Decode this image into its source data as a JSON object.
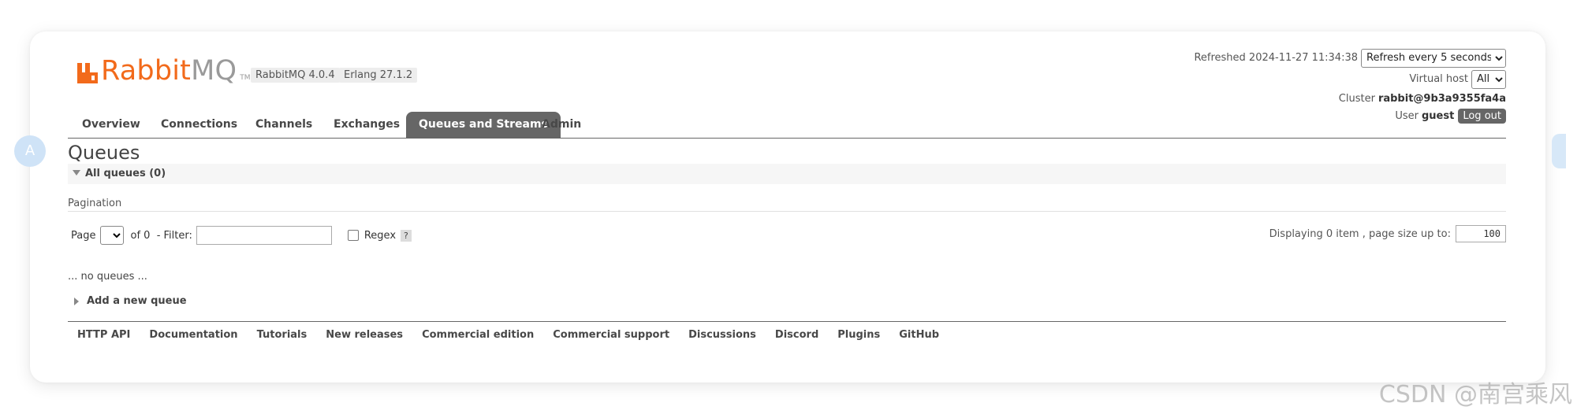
{
  "brand": {
    "name_orange": "Rabbit",
    "name_gray": "MQ",
    "tm": "TM",
    "rabbitmq_version": "RabbitMQ 4.0.4",
    "erlang_version": "Erlang 27.1.2",
    "colors": {
      "accent": "#f26a1b",
      "tab_active": "#666666"
    }
  },
  "status": {
    "refreshed_label": "Refreshed",
    "refreshed_time": "2024-11-27 11:34:38",
    "refresh_option": "Refresh every 5 seconds",
    "vhost_label": "Virtual host",
    "vhost_value": "All",
    "cluster_label": "Cluster",
    "cluster_value": "rabbit@9b3a9355fa4a",
    "user_label": "User",
    "user_value": "guest",
    "logout_label": "Log out"
  },
  "tabs": [
    {
      "label": "Overview",
      "active": false
    },
    {
      "label": "Connections",
      "active": false
    },
    {
      "label": "Channels",
      "active": false
    },
    {
      "label": "Exchanges",
      "active": false
    },
    {
      "label": "Queues and Streams",
      "active": true
    },
    {
      "label": "Admin",
      "active": false
    }
  ],
  "page": {
    "title": "Queues",
    "section_title": "All queues (0)",
    "pagination_label": "Pagination",
    "page_label": "Page",
    "of_label": "of 0",
    "filter_label": "- Filter:",
    "filter_value": "",
    "regex_label": "Regex",
    "help_label": "?",
    "display_label": "Displaying 0 item , page size up to:",
    "page_size": "100",
    "empty_text": "... no queues ...",
    "add_queue_label": "Add a new queue"
  },
  "footer": {
    "links": [
      "HTTP API",
      "Documentation",
      "Tutorials",
      "New releases",
      "Commercial edition",
      "Commercial support",
      "Discussions",
      "Discord",
      "Plugins",
      "GitHub"
    ]
  },
  "overlay": {
    "side_bubble_letter": "A",
    "watermark": "CSDN @南宫乘风"
  }
}
